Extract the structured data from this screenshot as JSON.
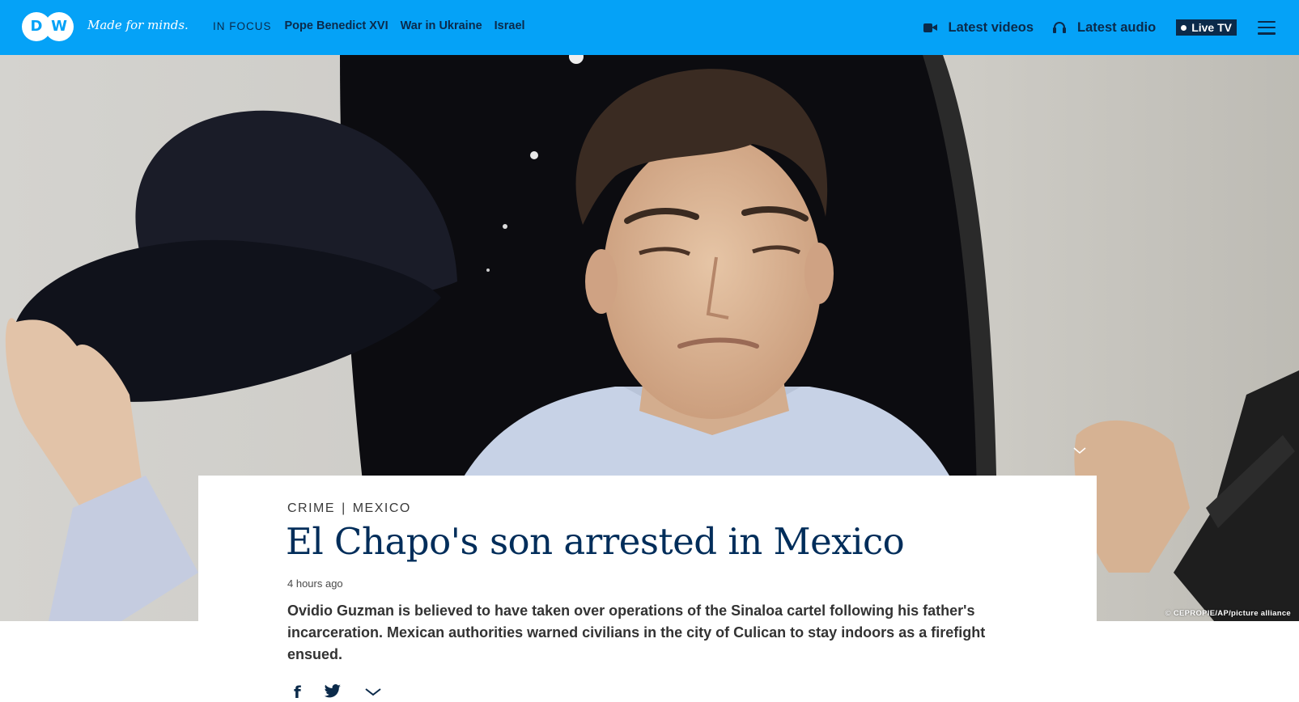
{
  "header": {
    "logo_text": "DW",
    "tagline": "Made for minds.",
    "in_focus_label": "IN FOCUS",
    "focus_links": [
      "Pope Benedict XVI",
      "War in Ukraine",
      "Israel"
    ],
    "latest_videos": "Latest videos",
    "latest_audio": "Latest audio",
    "live_tv": "Live TV",
    "brand_color": "#05a2f7",
    "nav_text_color": "#0b2a4a"
  },
  "hero": {
    "image_description_icon": "photo-man-holding-cap",
    "credit": "© CEPROPIE/AP/picture alliance"
  },
  "article": {
    "kicker_category": "CRIME",
    "kicker_separator": "|",
    "kicker_region": "MEXICO",
    "title": "El Chapo's son arrested in Mexico",
    "timestamp": "4 hours ago",
    "lead": "Ovidio Guzman is believed to have taken over operations of the Sinaloa cartel following his father's incarceration. Mexican authorities warned civilians in the city of Culican to stay indoors as a firefight ensued.",
    "title_color": "#002d5a"
  },
  "share": {
    "icons": [
      "facebook-icon",
      "twitter-icon",
      "chevron-down-icon"
    ]
  }
}
